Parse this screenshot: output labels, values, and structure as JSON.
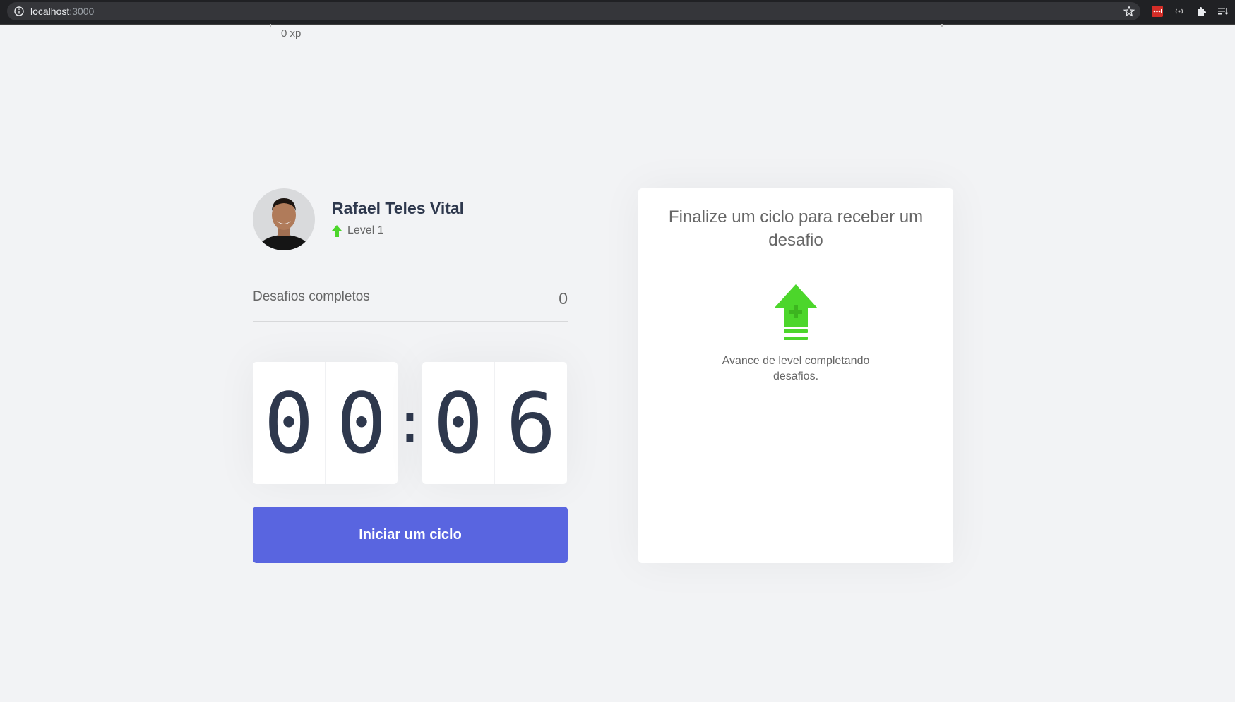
{
  "browser": {
    "url_host": "localhost",
    "url_port": ":3000"
  },
  "experience": {
    "current_label": "0 xp"
  },
  "profile": {
    "name": "Rafael Teles Vital",
    "level_label": "Level 1"
  },
  "completed_challenges": {
    "label": "Desafios completos",
    "count": "0"
  },
  "countdown": {
    "minute_left": "0",
    "minute_right": "0",
    "separator": ":",
    "second_left": "0",
    "second_right": "6"
  },
  "start_button": {
    "label": "Iniciar um ciclo"
  },
  "challenge_box": {
    "title": "Finalize um ciclo para receber um desafio",
    "description": "Avance de level completando desafios."
  },
  "colors": {
    "accent": "#5965e0",
    "level_green": "#4cd62b",
    "title_dark": "#2e384d",
    "background": "#f2f3f5"
  }
}
